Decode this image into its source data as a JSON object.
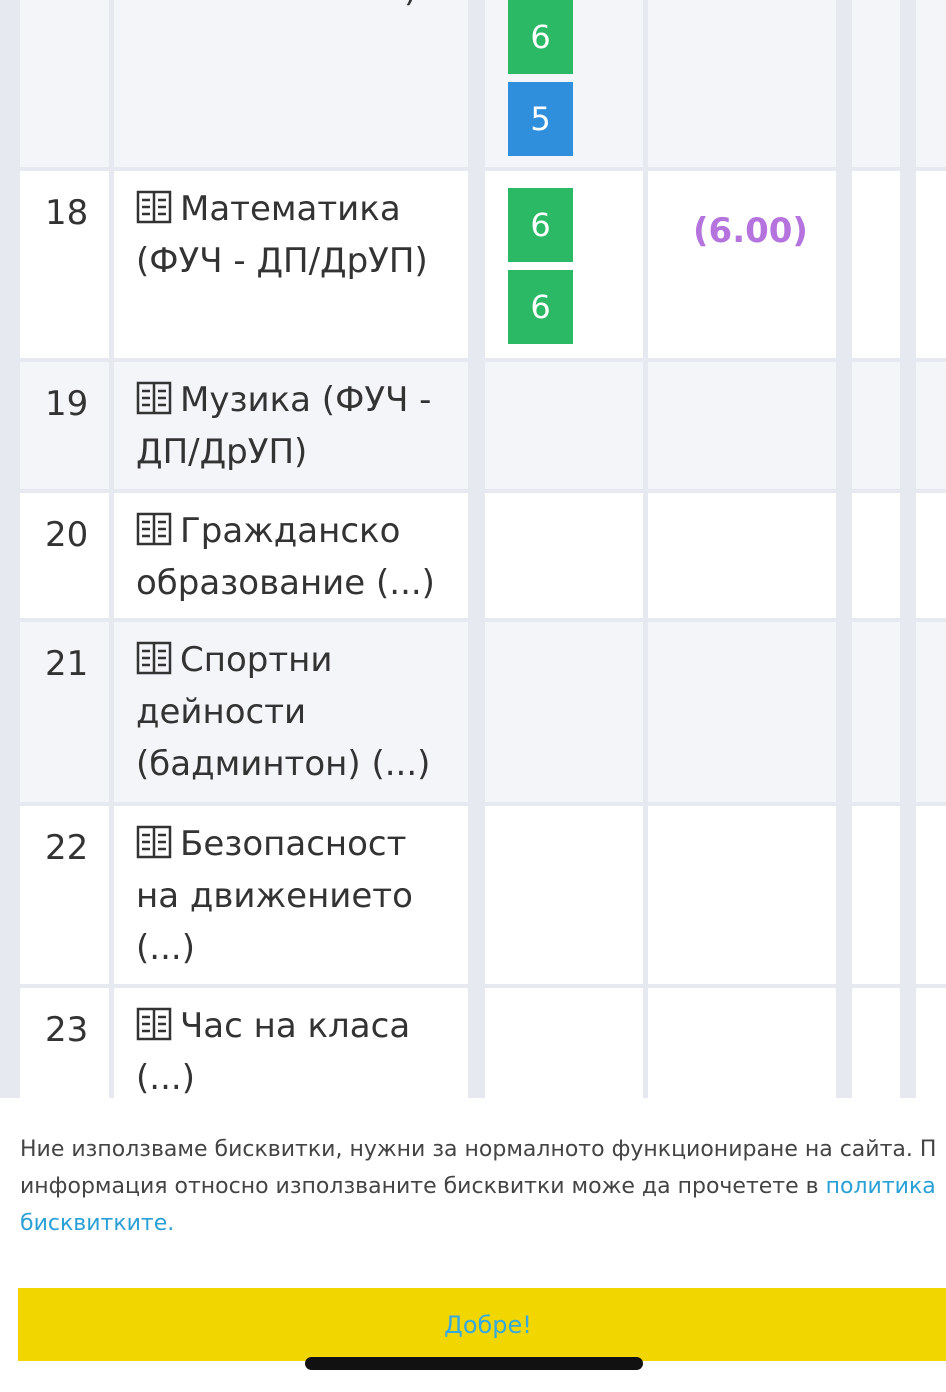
{
  "grades_table": {
    "rows": [
      {
        "num": "",
        "subject": ")",
        "grades": [
          "6",
          "5"
        ],
        "grade_colors": [
          "#2cb966",
          "#2f8fdd"
        ],
        "average": ""
      },
      {
        "num": "18",
        "subject": "Математика (ФУЧ - ДП/ДрУП)",
        "grades": [
          "6",
          "6"
        ],
        "grade_colors": [
          "#2cb966",
          "#2cb966"
        ],
        "average": "(6.00)"
      },
      {
        "num": "19",
        "subject": "Музика (ФУЧ - ДП/ДрУП)",
        "grades": [],
        "average": ""
      },
      {
        "num": "20",
        "subject": "Гражданско образование (...)",
        "grades": [],
        "average": ""
      },
      {
        "num": "21",
        "subject": "Спортни дейности (бадминтон) (...)",
        "grades": [],
        "average": ""
      },
      {
        "num": "22",
        "subject": "Безопасност на движението (...)",
        "grades": [],
        "average": ""
      },
      {
        "num": "23",
        "subject": "Час на класа (...)",
        "grades": [],
        "average": ""
      }
    ],
    "subject_icon": "book-icon"
  },
  "cookie_banner": {
    "line1": "Ние използваме бисквитки, нужни за нормалното функциониране на сайта. П",
    "line2_text": "информация относно използваните бисквитки може да прочетете в ",
    "line2_link": "политика",
    "line3_link": "бисквитките.",
    "ok_button": "Добре!"
  },
  "colors": {
    "grade_green": "#2cb966",
    "grade_blue": "#2f8fdd",
    "average_purple": "#b574dd",
    "button_yellow": "#f1d600",
    "link_blue": "#2aa0d6"
  }
}
